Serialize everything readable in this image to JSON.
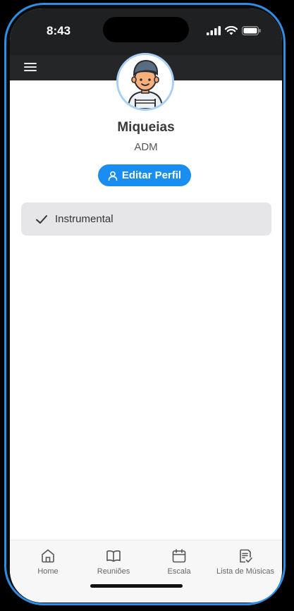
{
  "status_bar": {
    "time": "8:43"
  },
  "header": {
    "menu_icon": "hamburger-menu-icon"
  },
  "profile": {
    "avatar_icon": "user-avatar-illustration",
    "name": "Miqueias",
    "role": "ADM",
    "edit_button_label": "Editar Perfil",
    "edit_button_icon": "person-icon"
  },
  "tags": [
    {
      "label": "Instrumental",
      "icon": "check-icon"
    }
  ],
  "bottom_nav": {
    "items": [
      {
        "label": "Home",
        "icon": "home-icon"
      },
      {
        "label": "Reuniões",
        "icon": "book-icon"
      },
      {
        "label": "Escala",
        "icon": "calendar-icon"
      },
      {
        "label": "Lista de Músicas",
        "icon": "list-document-icon"
      }
    ]
  },
  "colors": {
    "accent": "#1a8df0",
    "frame": "#2f8de4",
    "appbar": "#252628",
    "card": "#e6e6e9"
  }
}
